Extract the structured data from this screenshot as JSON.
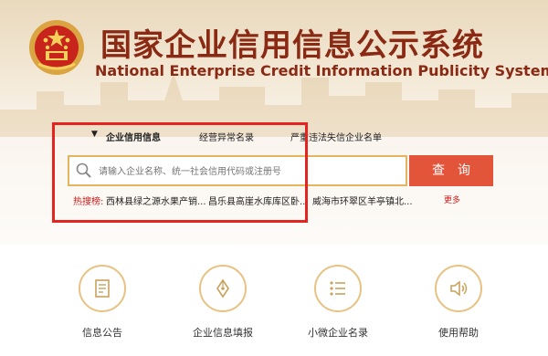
{
  "header": {
    "title_cn": "国家企业信用信息公示系统",
    "title_en": "National Enterprise Credit Information Publicity System"
  },
  "tabs": [
    {
      "label": "企业信用信息",
      "active": true
    },
    {
      "label": "经营异常名录",
      "active": false
    },
    {
      "label": "严重违法失信企业名单",
      "active": false
    }
  ],
  "search": {
    "placeholder": "请输入企业名称、统一社会信用代码或注册号",
    "button_label": "查询"
  },
  "hot_search": {
    "label": "热搜榜:",
    "items": [
      "西林县绿之源水果产销...",
      "昌乐县高崖水库库区卧...",
      "威海市环翠区羊亭镇北..."
    ],
    "more_label": "更多"
  },
  "nav": [
    {
      "label": "信息公告",
      "icon": "document-icon"
    },
    {
      "label": "企业信息填报",
      "icon": "pen-icon"
    },
    {
      "label": "小微企业名录",
      "icon": "list-icon"
    },
    {
      "label": "使用帮助",
      "icon": "speaker-icon"
    }
  ],
  "colors": {
    "brand": "#8b2a14",
    "accent_red": "#e3553a",
    "highlight_frame": "#e5231f",
    "gold": "#e8c283"
  }
}
